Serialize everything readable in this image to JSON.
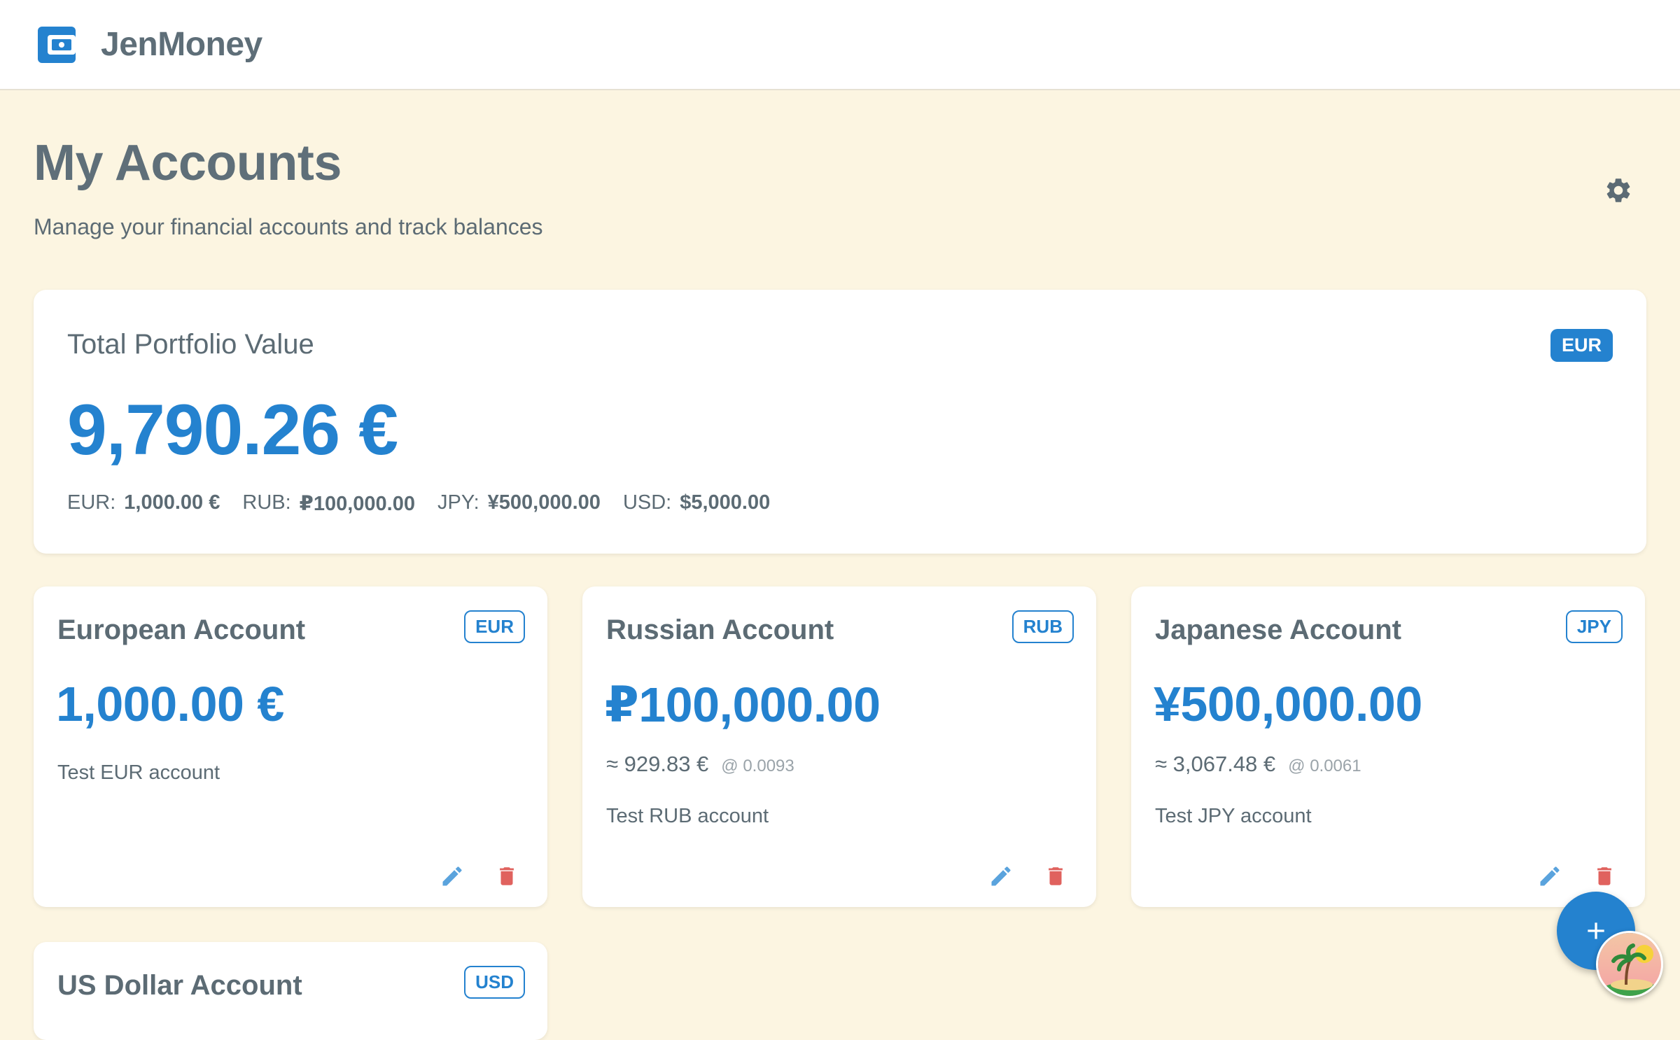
{
  "app": {
    "title": "JenMoney"
  },
  "page": {
    "title": "My Accounts",
    "subtitle": "Manage your financial accounts and track balances"
  },
  "portfolio": {
    "label": "Total Portfolio Value",
    "currency": "EUR",
    "total": "9,790.26 €",
    "breakdown": [
      {
        "code": "EUR:",
        "amount": "1,000.00 €"
      },
      {
        "code": "RUB:",
        "amount": "₽100,000.00"
      },
      {
        "code": "JPY:",
        "amount": "¥500,000.00"
      },
      {
        "code": "USD:",
        "amount": "$5,000.00"
      }
    ]
  },
  "accounts": [
    {
      "name": "European Account",
      "currency": "EUR",
      "balance": "1,000.00 €",
      "converted": "",
      "rate": "",
      "description": "Test EUR account"
    },
    {
      "name": "Russian Account",
      "currency": "RUB",
      "balance": "₽100,000.00",
      "converted": "≈ 929.83 €",
      "rate": "@ 0.0093",
      "description": "Test RUB account"
    },
    {
      "name": "Japanese Account",
      "currency": "JPY",
      "balance": "¥500,000.00",
      "converted": "≈ 3,067.48 €",
      "rate": "@ 0.0061",
      "description": "Test JPY account"
    },
    {
      "name": "US Dollar Account",
      "currency": "USD"
    }
  ],
  "colors": {
    "accent": "#2482cf",
    "delete": "#e0625e",
    "edit": "#5aa3dd",
    "background": "#fcf5e1"
  },
  "icons": {
    "logo": "wallet-icon",
    "settings": "gear-icon",
    "edit": "pencil-icon",
    "delete": "trash-icon",
    "fab": "plus-icon"
  }
}
